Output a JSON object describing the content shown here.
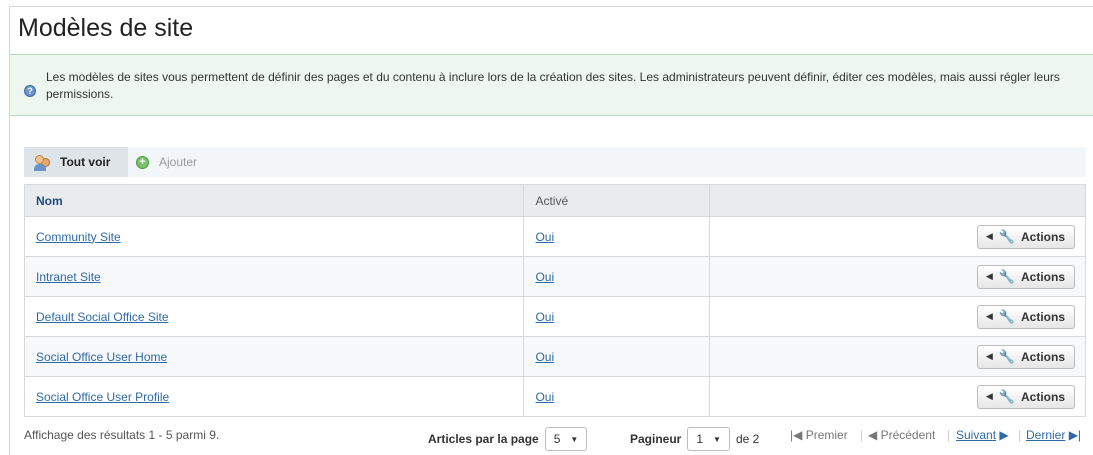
{
  "page": {
    "title": "Modèles de site"
  },
  "info": {
    "text": "Les modèles de sites vous permettent de définir des pages et du contenu à inclure lors de la création des sites. Les administrateurs peuvent définir, éditer ces modèles, mais aussi régler leurs permissions."
  },
  "toolbar": {
    "view_all": "Tout voir",
    "add": "Ajouter"
  },
  "table": {
    "headers": [
      "Nom",
      "Activé",
      ""
    ],
    "rows": [
      {
        "name": "Community Site",
        "active": "Oui",
        "action": "Actions"
      },
      {
        "name": "Intranet Site",
        "active": "Oui",
        "action": "Actions"
      },
      {
        "name": "Default Social Office Site",
        "active": "Oui",
        "action": "Actions"
      },
      {
        "name": "Social Office User Home",
        "active": "Oui",
        "action": "Actions"
      },
      {
        "name": "Social Office User Profile",
        "active": "Oui",
        "action": "Actions"
      }
    ]
  },
  "footer": {
    "results": "Affichage des résultats 1 - 5 parmi 9.",
    "per_page_label": "Articles par la page",
    "per_page_value": "5",
    "pager_label": "Pagineur",
    "page_value": "1",
    "page_total": "de 2",
    "first": "Premier",
    "previous": "Précédent",
    "next": "Suivant",
    "last": "Dernier"
  },
  "icons": {
    "info": "info-icon",
    "view_all": "users-icon",
    "add": "plus-icon",
    "actions": "wrench-icon"
  }
}
